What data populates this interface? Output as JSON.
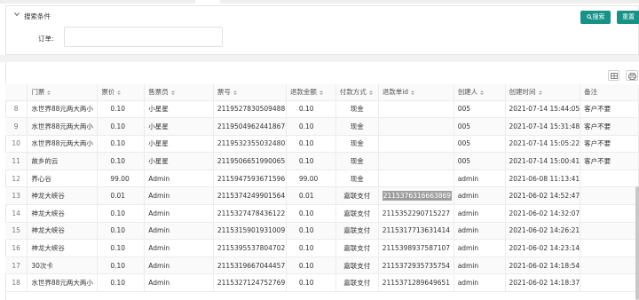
{
  "search": {
    "title": "搜索条件",
    "search_label": "搜索",
    "reset_label": "重置",
    "order_label": "订单:",
    "order_value": ""
  },
  "table": {
    "columns": [
      "门票",
      "票价",
      "售票员",
      "票号",
      "退款金额",
      "付款方式",
      "退款单id",
      "创建人",
      "创建时间",
      "备注"
    ],
    "rows": [
      {
        "num": "8",
        "ticket": "水世界88元两大两小",
        "price": "0.10",
        "seller": "小星星",
        "ticket_no": "2119527830509488",
        "refund": "0.10",
        "pay": "现金",
        "refund_id": "",
        "creator": "005",
        "created": "2021-07-14 15:44:05",
        "note": "客户不要"
      },
      {
        "num": "9",
        "ticket": "水世界88元两大两小",
        "price": "0.10",
        "seller": "小星星",
        "ticket_no": "2119504962441867",
        "refund": "0.10",
        "pay": "现金",
        "refund_id": "",
        "creator": "005",
        "created": "2021-07-14 15:31:48",
        "note": "客户不要"
      },
      {
        "num": "10",
        "ticket": "水世界88元两大两小",
        "price": "0.10",
        "seller": "小星星",
        "ticket_no": "2119532355032480",
        "refund": "0.10",
        "pay": "现金",
        "refund_id": "",
        "creator": "005",
        "created": "2021-07-14 15:05:22",
        "note": "客户不要"
      },
      {
        "num": "11",
        "ticket": "故乡的云",
        "price": "0.10",
        "seller": "小星星",
        "ticket_no": "2119506651990065",
        "refund": "0.10",
        "pay": "现金",
        "refund_id": "",
        "creator": "005",
        "created": "2021-07-14 15:00:41",
        "note": "客户不要"
      },
      {
        "num": "12",
        "ticket": "养心谷",
        "price": "99.00",
        "seller": "Admin",
        "ticket_no": "2115947593671596",
        "refund": "99.00",
        "pay": "现金",
        "refund_id": "",
        "creator": "admin",
        "created": "2021-06-08 11:13:41",
        "note": ""
      },
      {
        "num": "13",
        "ticket": "神龙大峡谷",
        "price": "0.01",
        "seller": "Admin",
        "ticket_no": "2115374249901564",
        "refund": "0.01",
        "pay": "嘉联支付",
        "refund_id": "2115376316663869",
        "creator": "admin",
        "created": "2021-06-02 14:52:47",
        "note": ""
      },
      {
        "num": "14",
        "ticket": "神龙大峡谷",
        "price": "0.10",
        "seller": "Admin",
        "ticket_no": "2115327478436122",
        "refund": "0.10",
        "pay": "嘉联支付",
        "refund_id": "2115352290715227",
        "creator": "admin",
        "created": "2021-06-02 14:32:07",
        "note": ""
      },
      {
        "num": "15",
        "ticket": "神龙大峡谷",
        "price": "0.10",
        "seller": "Admin",
        "ticket_no": "2115315901931009",
        "refund": "0.10",
        "pay": "嘉联支付",
        "refund_id": "2115317713631414",
        "creator": "admin",
        "created": "2021-06-02 14:26:21",
        "note": ""
      },
      {
        "num": "16",
        "ticket": "神龙大峡谷",
        "price": "0.10",
        "seller": "Admin",
        "ticket_no": "2115395537804702",
        "refund": "0.10",
        "pay": "嘉联支付",
        "refund_id": "2115398937587107",
        "creator": "admin",
        "created": "2021-06-02 14:23:14",
        "note": ""
      },
      {
        "num": "17",
        "ticket": "30次卡",
        "price": "0.10",
        "seller": "Admin",
        "ticket_no": "2115319667044457",
        "refund": "0.10",
        "pay": "嘉联支付",
        "refund_id": "2115372935735754",
        "creator": "admin",
        "created": "2021-06-02 14:18:54",
        "note": ""
      },
      {
        "num": "18",
        "ticket": "水世界88元两大两小",
        "price": "0.10",
        "seller": "Admin",
        "ticket_no": "2115327124752769",
        "refund": "0.10",
        "pay": "嘉联支付",
        "refund_id": "2115371289649651",
        "creator": "admin",
        "created": "2021-06-02 14:18:37",
        "note": ""
      }
    ]
  },
  "colors": {
    "accent": "#189186",
    "highlight": "#9e9e9e"
  }
}
